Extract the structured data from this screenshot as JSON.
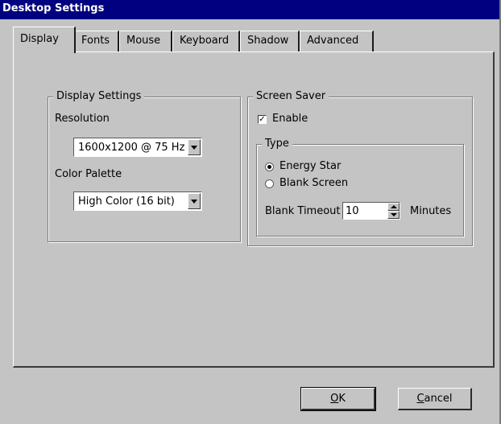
{
  "window": {
    "title": "Desktop Settings"
  },
  "tabs": [
    {
      "label": "Display",
      "active": true
    },
    {
      "label": "Fonts"
    },
    {
      "label": "Mouse"
    },
    {
      "label": "Keyboard"
    },
    {
      "label": "Shadow"
    },
    {
      "label": "Advanced"
    }
  ],
  "display_settings": {
    "legend": "Display Settings",
    "resolution_label": "Resolution",
    "resolution_value": "1600x1200 @ 75 Hz",
    "palette_label": "Color Palette",
    "palette_value": "High Color (16 bit)"
  },
  "screen_saver": {
    "legend": "Screen Saver",
    "enable_label": "Enable",
    "enable_checked": true,
    "type_legend": "Type",
    "options": [
      {
        "label": "Energy Star",
        "selected": true
      },
      {
        "label": "Blank Screen",
        "selected": false
      }
    ],
    "timeout_label": "Blank Timeout",
    "timeout_value": "10",
    "timeout_unit": "Minutes"
  },
  "buttons": {
    "ok_mnemonic": "O",
    "ok_rest": "K",
    "cancel_mnemonic": "C",
    "cancel_rest": "ancel"
  }
}
